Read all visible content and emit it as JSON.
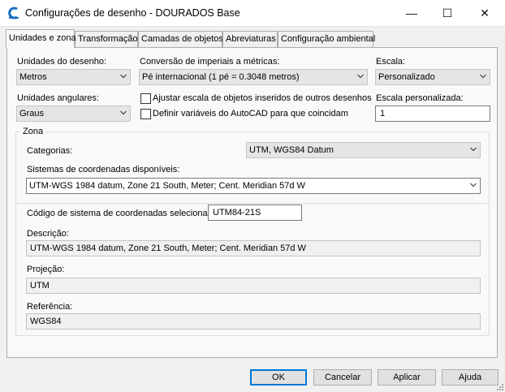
{
  "window": {
    "title": "Configurações de desenho - DOURADOS Base",
    "minimize_glyph": "—",
    "maximize_glyph": "☐",
    "close_glyph": "✕"
  },
  "tabs": [
    {
      "label": "Unidades e zona",
      "active": true
    },
    {
      "label": "Transformação",
      "active": false
    },
    {
      "label": "Camadas de objetos",
      "active": false
    },
    {
      "label": "Abreviaturas",
      "active": false
    },
    {
      "label": "Configuração ambiental",
      "active": false
    }
  ],
  "units": {
    "drawing_units_label": "Unidades do desenho:",
    "drawing_units_value": "Metros",
    "imperial_label": "Conversão de imperiais a métricas:",
    "imperial_value": "Pé internacional (1 pé = 0.3048 metros)",
    "scale_label": "Escala:",
    "scale_value": "Personalizado",
    "angular_label": "Unidades angulares:",
    "angular_value": "Graus",
    "scale_objects_label": "Ajustar escala de objetos inseridos de outros desenhos",
    "scale_objects_checked": false,
    "set_vars_label": "Definir variáveis do AutoCAD para que coincidam",
    "set_vars_checked": false,
    "custom_scale_label": "Escala personalizada:",
    "custom_scale_value": "1"
  },
  "zone": {
    "legend": "Zona",
    "categories_label": "Categorias:",
    "categories_value": "UTM, WGS84 Datum",
    "available_label": "Sistemas de coordenadas disponíveis:",
    "available_value": "UTM-WGS 1984 datum, Zone 21 South, Meter; Cent. Meridian 57d W",
    "code_label": "Código de sistema de coordenadas selecionado:",
    "code_value": "UTM84-21S",
    "description_label": "Descrição:",
    "description_value": "UTM-WGS 1984 datum, Zone 21 South, Meter; Cent. Meridian 57d W",
    "projection_label": "Projeção:",
    "projection_value": "UTM",
    "reference_label": "Referência:",
    "reference_value": "WGS84"
  },
  "footer": {
    "ok": "OK",
    "cancel": "Cancelar",
    "apply": "Aplicar",
    "help": "Ajuda"
  },
  "colors": {
    "accent": "#0078d7",
    "app_icon": "#1a6fc4"
  },
  "icons": [
    "civil3d-app-icon",
    "chevron-down-icon",
    "minimize-icon",
    "maximize-icon",
    "close-icon",
    "resize-grip-icon"
  ]
}
